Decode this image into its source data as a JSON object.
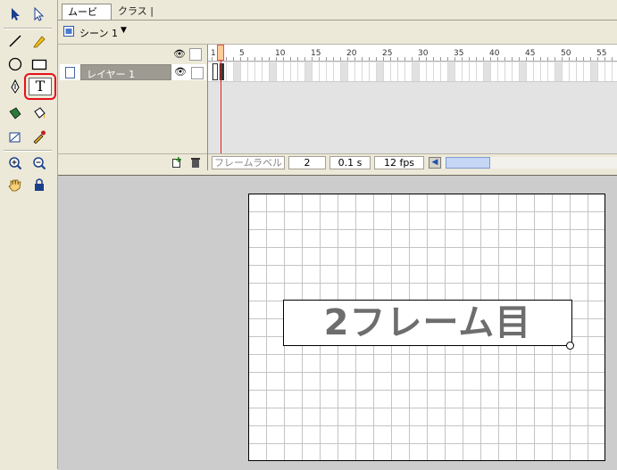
{
  "tabs": {
    "movie": "ムービー",
    "class": "クラス"
  },
  "scene": {
    "label": "シーン 1",
    "chevron": "▼"
  },
  "timeline": {
    "eye_glyph": "👁",
    "layer_name": "レイヤー 1",
    "ruler": [
      "1",
      "5",
      "10",
      "15",
      "20",
      "25",
      "30",
      "35",
      "40",
      "45",
      "50",
      "55"
    ],
    "current_frame": "2",
    "elapsed_time": "0.1 s",
    "frame_rate": "12 fps",
    "frame_label_placeholder": "フレームラベル"
  },
  "toolbox": {
    "text_tool_glyph": "T"
  },
  "stage": {
    "text": "2フレーム目"
  },
  "colors": {
    "highlight": "#e8101b",
    "playhead": "#e31e1e",
    "text": "#6d6d6d"
  }
}
